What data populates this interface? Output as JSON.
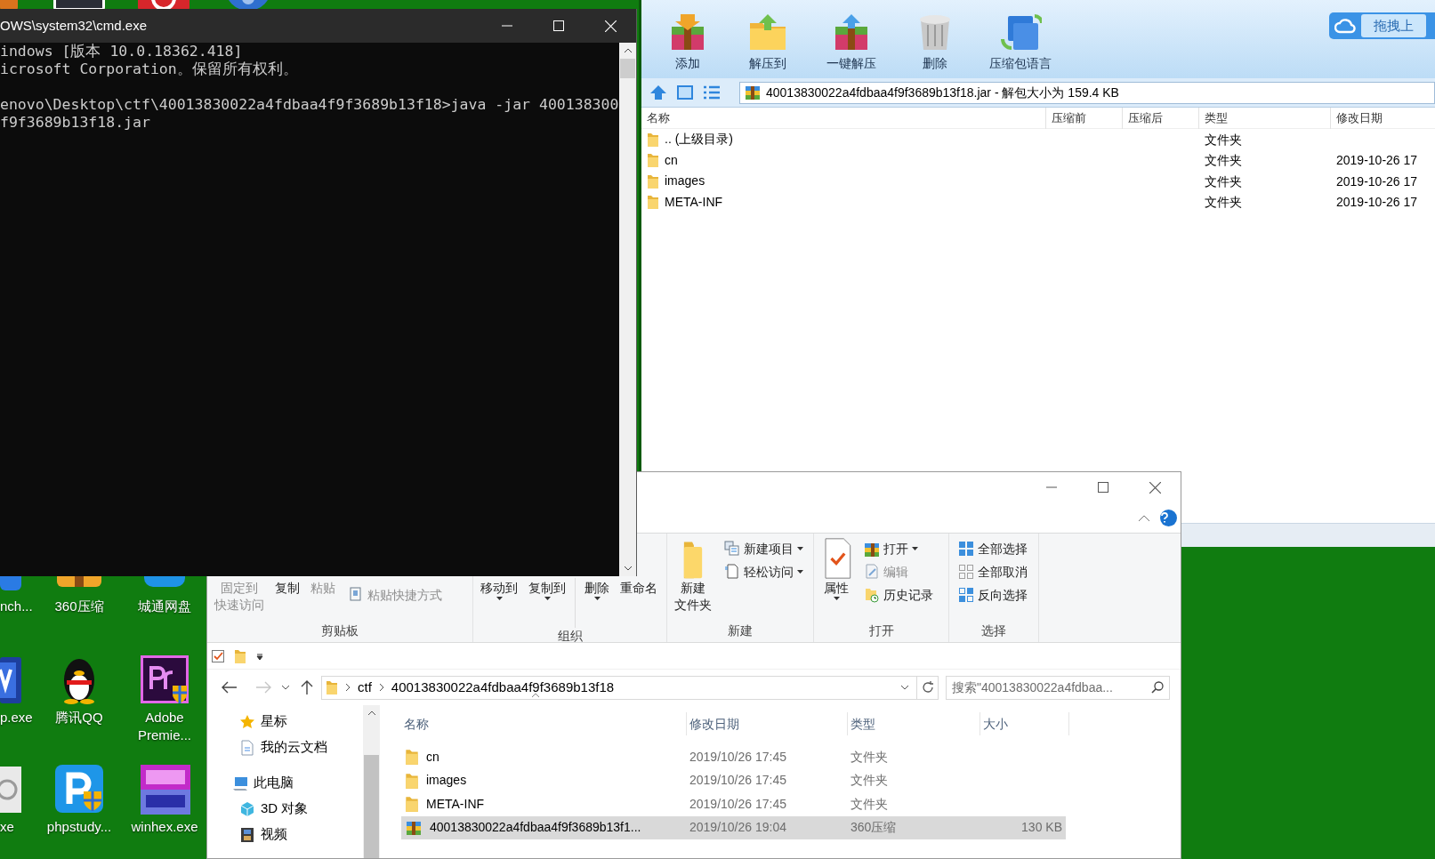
{
  "desktop_icons": [
    {
      "label": "nch..."
    },
    {
      "label": "360压缩"
    },
    {
      "label": "城通网盘"
    },
    {
      "label": "p.exe"
    },
    {
      "label": "腾讯QQ"
    },
    {
      "label": "Adobe Premie..."
    },
    {
      "label": "xe"
    },
    {
      "label": "phpstudy..."
    },
    {
      "label": "winhex.exe"
    }
  ],
  "cmd": {
    "title": "OWS\\system32\\cmd.exe",
    "header_lines": [
      "indows [版本 10.0.18362.418]",
      "icrosoft Corporation。保留所有权利。"
    ],
    "prompt_lines": [
      "enovo\\Desktop\\ctf\\40013830022a4fdbaa4f9f3689b13f18>java -jar 400138300",
      "f9f3689b13f18.jar"
    ]
  },
  "archive_window": {
    "toolbar": [
      "添加",
      "解压到",
      "一键解压",
      "删除",
      "压缩包语言"
    ],
    "upload_button": "拖拽上",
    "address": "40013830022a4fdbaa4f9f3689b13f18.jar - 解包大小为 159.4 KB",
    "columns": [
      "名称",
      "压缩前",
      "压缩后",
      "类型",
      "修改日期"
    ],
    "rows": [
      {
        "name": ".. (上级目录)",
        "type": "文件夹"
      },
      {
        "name": "cn",
        "type": "文件夹",
        "modified": "2019-10-26 17"
      },
      {
        "name": "images",
        "type": "文件夹",
        "modified": "2019-10-26 17"
      },
      {
        "name": "META-INF",
        "type": "文件夹",
        "modified": "2019-10-26 17"
      }
    ]
  },
  "explorer": {
    "ribbon_groups": [
      {
        "label": "剪贴板",
        "items": [
          {
            "kind": "large",
            "lines": [
              "固定到",
              "快速访问"
            ],
            "disabled": true,
            "dropdown": false
          },
          {
            "kind": "large",
            "lines": [
              "复制"
            ],
            "disabled": false,
            "dropdown": false
          },
          {
            "kind": "large",
            "lines": [
              "粘贴"
            ],
            "disabled": true,
            "dropdown": false
          },
          {
            "kind": "small",
            "label": "粘贴快捷方式",
            "disabled": true,
            "dropdown": false
          }
        ]
      },
      {
        "label": "组织",
        "items": [
          {
            "kind": "large",
            "lines": [
              "移动到"
            ],
            "disabled": false,
            "dropdown": true
          },
          {
            "kind": "large",
            "lines": [
              "复制到"
            ],
            "disabled": false,
            "dropdown": true
          },
          {
            "kind": "separator"
          },
          {
            "kind": "large",
            "lines": [
              "删除"
            ],
            "disabled": false,
            "dropdown": true
          },
          {
            "kind": "large",
            "lines": [
              "重命名"
            ],
            "disabled": false,
            "dropdown": false
          }
        ]
      },
      {
        "label": "新建",
        "items": [
          {
            "kind": "large",
            "lines": [
              "新建",
              "文件夹"
            ],
            "disabled": false,
            "dropdown": false,
            "icon_shown": true
          },
          {
            "kind": "small",
            "label": "新建项目",
            "disabled": false,
            "dropdown": true
          },
          {
            "kind": "small",
            "label": "轻松访问",
            "disabled": false,
            "dropdown": true
          }
        ]
      },
      {
        "label": "打开",
        "items": [
          {
            "kind": "large",
            "lines": [
              "属性"
            ],
            "disabled": false,
            "dropdown": true,
            "icon_shown": true
          },
          {
            "kind": "small",
            "label": "打开",
            "disabled": false,
            "dropdown": true
          },
          {
            "kind": "small",
            "label": "编辑",
            "disabled": true,
            "dropdown": false
          },
          {
            "kind": "small",
            "label": "历史记录",
            "disabled": false,
            "dropdown": false
          }
        ]
      },
      {
        "label": "选择",
        "items": [
          {
            "kind": "small",
            "label": "全部选择",
            "disabled": false,
            "dropdown": false
          },
          {
            "kind": "small",
            "label": "全部取消",
            "disabled": false,
            "dropdown": false
          },
          {
            "kind": "small",
            "label": "反向选择",
            "disabled": false,
            "dropdown": false
          }
        ]
      }
    ],
    "breadcrumb": [
      "ctf",
      "40013830022a4fdbaa4f9f3689b13f18"
    ],
    "search": {
      "placeholder": "搜索\"40013830022a4fdbaa..."
    },
    "nav_items": [
      {
        "label": "星标",
        "section_start": false
      },
      {
        "label": "我的云文档",
        "section_start": false
      },
      {
        "label": "此电脑",
        "section_start": true
      },
      {
        "label": "3D 对象",
        "section_start": false
      },
      {
        "label": "视频",
        "section_start": false
      }
    ],
    "columns": [
      "名称",
      "修改日期",
      "类型",
      "大小"
    ],
    "files": [
      {
        "name": "cn",
        "modified": "2019/10/26 17:45",
        "type": "文件夹",
        "kind": "folder",
        "selected": false
      },
      {
        "name": "images",
        "modified": "2019/10/26 17:45",
        "type": "文件夹",
        "kind": "folder",
        "selected": false
      },
      {
        "name": "META-INF",
        "modified": "2019/10/26 17:45",
        "type": "文件夹",
        "kind": "folder",
        "selected": false
      },
      {
        "name": "40013830022a4fdbaa4f9f3689b13f1...",
        "modified": "2019/10/26 19:04",
        "type": "360压缩",
        "size": "130 KB",
        "kind": "archive",
        "selected": true
      }
    ]
  }
}
